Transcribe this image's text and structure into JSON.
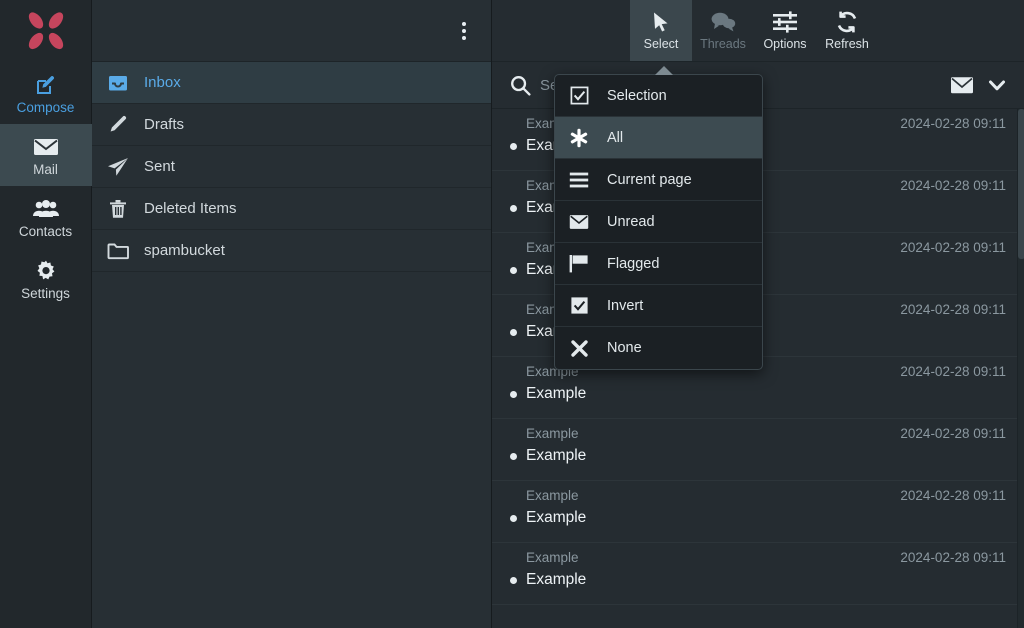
{
  "brand": {
    "logo_icon": "butterfly-logo",
    "logo_color": "#c6455d"
  },
  "rail": {
    "items": [
      {
        "label": "Compose",
        "icon": "compose-pencil-icon",
        "active": false,
        "accent": "#4a9fe0"
      },
      {
        "label": "Mail",
        "icon": "envelope-icon",
        "active": true
      },
      {
        "label": "Contacts",
        "icon": "people-icon",
        "active": false
      },
      {
        "label": "Settings",
        "icon": "gear-icon",
        "active": false
      }
    ]
  },
  "folders": {
    "kebab_icon": "kebab-menu-icon",
    "items": [
      {
        "label": "Inbox",
        "icon": "inbox-tray-icon",
        "active": true
      },
      {
        "label": "Drafts",
        "icon": "pencil-icon",
        "active": false
      },
      {
        "label": "Sent",
        "icon": "paper-plane-icon",
        "active": false
      },
      {
        "label": "Deleted Items",
        "icon": "trash-icon",
        "active": false
      },
      {
        "label": "spambucket",
        "icon": "folder-icon",
        "active": false
      }
    ]
  },
  "toolbar": {
    "buttons": [
      {
        "label": "Select",
        "icon": "cursor-arrow-icon",
        "active": true,
        "disabled": false
      },
      {
        "label": "Threads",
        "icon": "speech-bubbles-icon",
        "active": false,
        "disabled": true
      },
      {
        "label": "Options",
        "icon": "sliders-icon",
        "active": false,
        "disabled": false
      },
      {
        "label": "Refresh",
        "icon": "refresh-icon",
        "active": false,
        "disabled": false
      }
    ]
  },
  "search": {
    "icon": "search-icon",
    "value": "",
    "placeholder": "Search...",
    "scope_icon": "envelope-icon",
    "chevron_icon": "chevron-down-icon"
  },
  "select_menu": {
    "open": true,
    "items": [
      {
        "label": "Selection",
        "icon": "checkbox-checked-icon",
        "active": false
      },
      {
        "label": "All",
        "icon": "asterisk-icon",
        "active": true
      },
      {
        "label": "Current page",
        "icon": "list-lines-icon",
        "active": false
      },
      {
        "label": "Unread",
        "icon": "envelope-icon",
        "active": false
      },
      {
        "label": "Flagged",
        "icon": "flag-icon",
        "active": false
      },
      {
        "label": "Invert",
        "icon": "checkbox-checked-icon",
        "active": false
      },
      {
        "label": "None",
        "icon": "x-mark-icon",
        "active": false
      }
    ]
  },
  "messages": [
    {
      "from": "Example",
      "subject": "Example",
      "date": "2024-02-28 09:11",
      "unread": true
    },
    {
      "from": "Example",
      "subject": "Example",
      "date": "2024-02-28 09:11",
      "unread": true
    },
    {
      "from": "Example",
      "subject": "Example",
      "date": "2024-02-28 09:11",
      "unread": true
    },
    {
      "from": "Example",
      "subject": "Example",
      "date": "2024-02-28 09:11",
      "unread": true
    },
    {
      "from": "Example",
      "subject": "Example",
      "date": "2024-02-28 09:11",
      "unread": true
    },
    {
      "from": "Example",
      "subject": "Example",
      "date": "2024-02-28 09:11",
      "unread": true
    },
    {
      "from": "Example",
      "subject": "Example",
      "date": "2024-02-28 09:11",
      "unread": true
    },
    {
      "from": "Example",
      "subject": "Example",
      "date": "2024-02-28 09:11",
      "unread": true
    }
  ]
}
